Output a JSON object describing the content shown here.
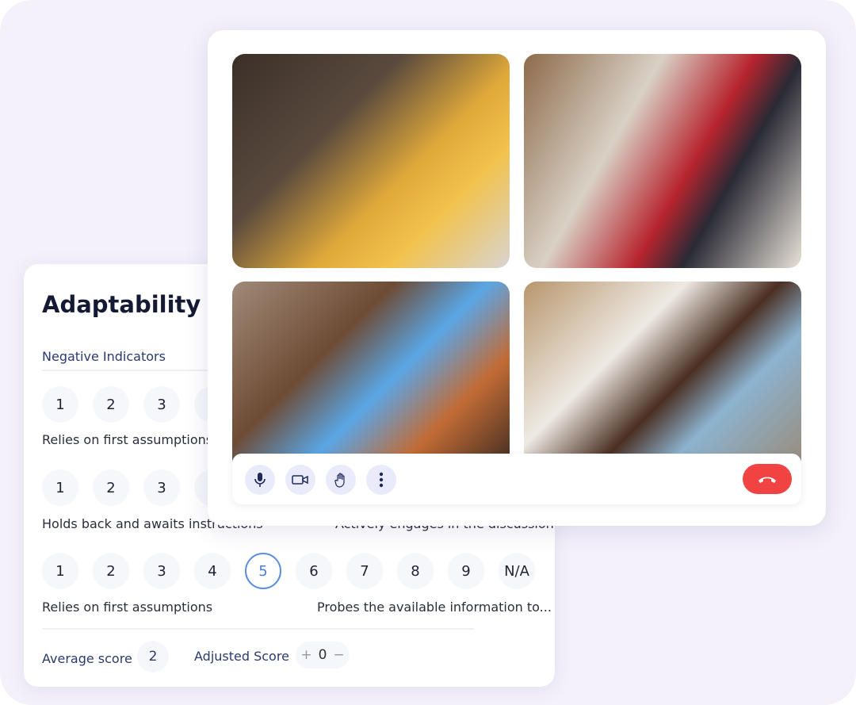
{
  "panel": {
    "title": "Adaptability",
    "section": "Negative Indicators",
    "rows": [
      {
        "left": "Relies on first assumptions",
        "right": ""
      },
      {
        "left": "Holds back and awaits instructions",
        "right": "Actively engages in the discussion"
      },
      {
        "left": "Relies on first assumptions",
        "right": "Probes the available information to..."
      }
    ],
    "scale": [
      "1",
      "2",
      "3",
      "4",
      "5",
      "6",
      "7",
      "8",
      "9",
      "N/A"
    ],
    "selected": "5",
    "average_label": "Average score",
    "average_value": "2",
    "adjusted_label": "Adjusted Score",
    "adjusted_plus": "+",
    "adjusted_value": "0",
    "adjusted_minus": "−"
  },
  "call": {
    "participants": 4,
    "controls": [
      "microphone-icon",
      "video-camera-icon",
      "raise-hand-icon",
      "more-vertical-icon"
    ],
    "end_call_color": "#f24343"
  }
}
